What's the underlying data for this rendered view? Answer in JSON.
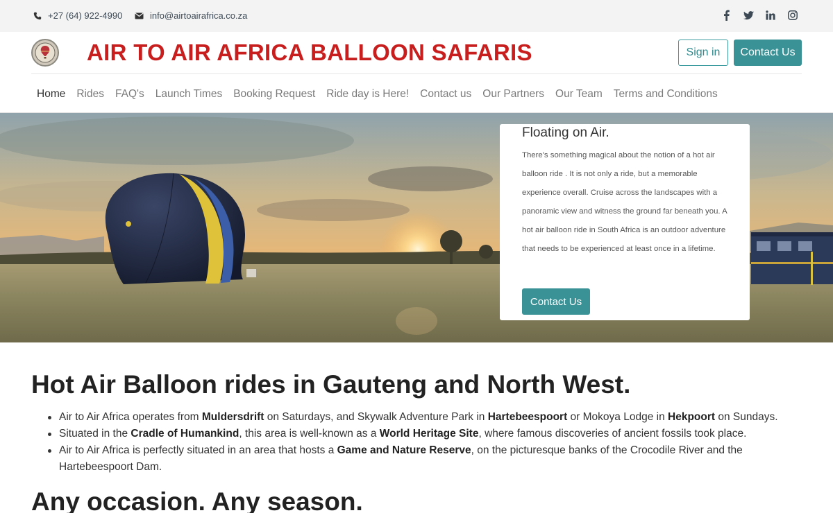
{
  "topbar": {
    "phone": "+27 (64) 922-4990",
    "email": "info@airtoairafrica.co.za",
    "social": [
      "facebook-icon",
      "twitter-icon",
      "linkedin-icon",
      "instagram-icon"
    ]
  },
  "header": {
    "brand": "AIR TO AIR AFRICA BALLOON SAFARIS",
    "sign_in": "Sign in",
    "contact_us": "Contact Us"
  },
  "nav": {
    "items": [
      {
        "label": "Home"
      },
      {
        "label": "Rides"
      },
      {
        "label": "FAQ's"
      },
      {
        "label": "Launch Times"
      },
      {
        "label": "Booking Request"
      },
      {
        "label": "Ride day is Here!"
      },
      {
        "label": "Contact us"
      },
      {
        "label": "Our Partners"
      },
      {
        "label": "Our Team"
      },
      {
        "label": "Terms and Conditions"
      }
    ]
  },
  "hero": {
    "card_title": "Floating on Air.",
    "card_text": "There's something magical about the notion of a hot air balloon ride . It is not only a ride, but a memorable experience overall. Cruise across the landscapes with a panoramic view and witness the ground far beneath you. A hot air balloon ride in South Africa is an outdoor adventure that needs to be experienced at least once in a lifetime.",
    "card_button": "Contact Us"
  },
  "content": {
    "heading": "Hot Air Balloon rides in Gauteng and North West.",
    "bullets": [
      [
        {
          "t": "Air to Air Africa operates from "
        },
        {
          "t": "Muldersdrift",
          "b": true
        },
        {
          "t": " on Saturdays, and Skywalk Adventure Park in "
        },
        {
          "t": "Hartebeespoort",
          "b": true
        },
        {
          "t": " or Mokoya Lodge in "
        },
        {
          "t": "Hekpoort",
          "b": true
        },
        {
          "t": " on Sundays."
        }
      ],
      [
        {
          "t": "Situated in the "
        },
        {
          "t": "Cradle of Humankind",
          "b": true
        },
        {
          "t": ", this area is well-known as a "
        },
        {
          "t": "World Heritage Site",
          "b": true
        },
        {
          "t": ", where famous discoveries of ancient fossils took place."
        }
      ],
      [
        {
          "t": "Air to Air Africa is perfectly situated in an area that hosts a "
        },
        {
          "t": "Game and Nature Reserve",
          "b": true
        },
        {
          "t": ", on the picturesque banks of the Crocodile River and the Hartebeespoort Dam."
        }
      ]
    ],
    "heading2": "Any occasion. Any season."
  },
  "colors": {
    "brand_red": "#c81e1e",
    "teal": "#3a9296",
    "topbar_bg": "#f3f3f3"
  }
}
